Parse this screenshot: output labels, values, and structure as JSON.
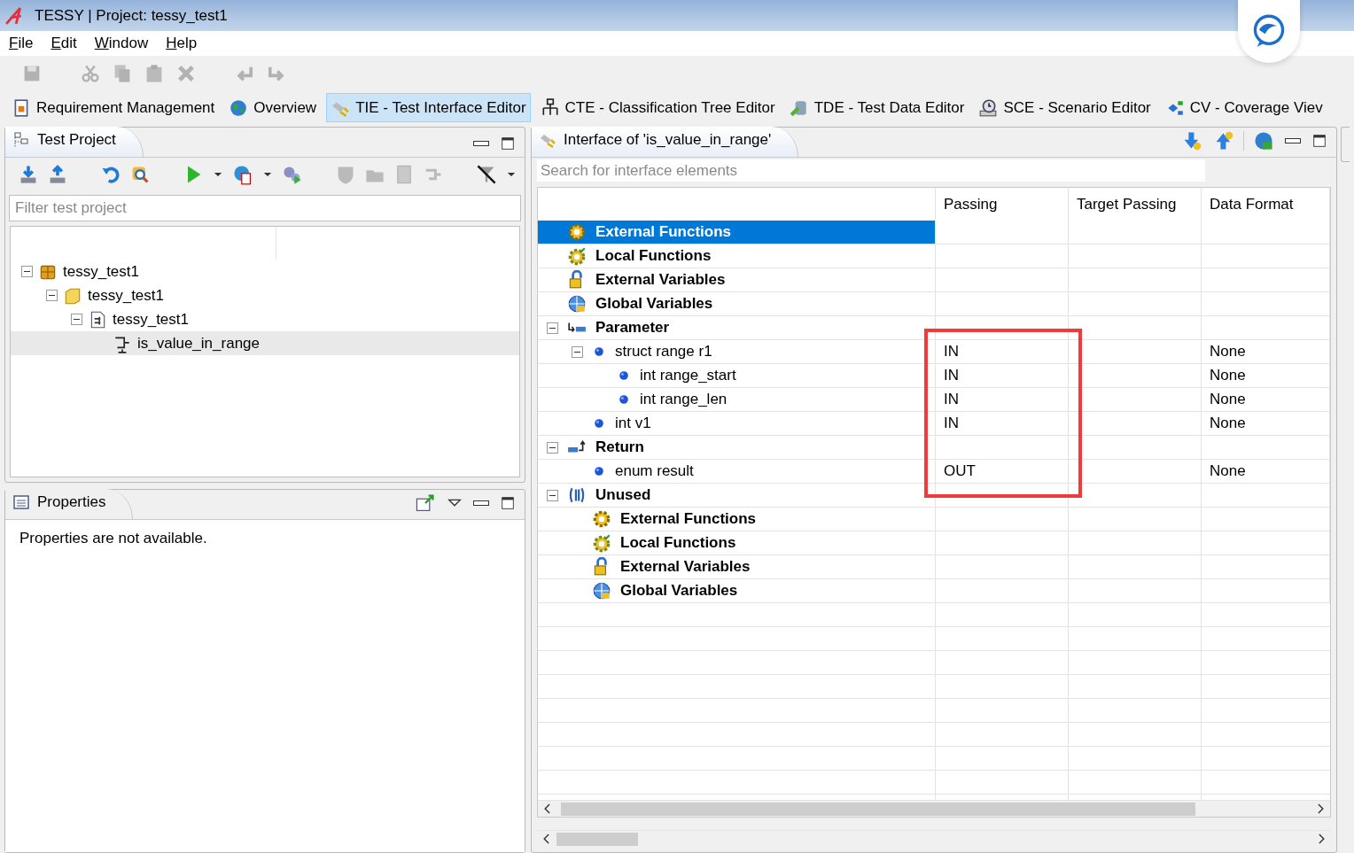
{
  "window": {
    "title": "TESSY | Project: tessy_test1"
  },
  "menu": [
    {
      "label": "File"
    },
    {
      "label": "Edit"
    },
    {
      "label": "Window"
    },
    {
      "label": "Help"
    }
  ],
  "toolbar": [
    {
      "kind": "save",
      "disabled": true
    },
    {
      "kind": "sep"
    },
    {
      "kind": "cut",
      "disabled": true
    },
    {
      "kind": "copy",
      "disabled": true
    },
    {
      "kind": "paste",
      "disabled": true
    },
    {
      "kind": "delete",
      "disabled": true
    },
    {
      "kind": "sep"
    },
    {
      "kind": "undo",
      "disabled": true
    },
    {
      "kind": "redo",
      "disabled": true
    }
  ],
  "perspectives": [
    {
      "label": "Requirement Management",
      "kind": "req",
      "selected": false
    },
    {
      "label": "Overview",
      "kind": "globe",
      "selected": false
    },
    {
      "label": "TIE - Test Interface Editor",
      "kind": "tie",
      "selected": true
    },
    {
      "label": "CTE - Classification Tree Editor",
      "kind": "cte",
      "selected": false
    },
    {
      "label": "TDE - Test Data Editor",
      "kind": "tde",
      "selected": false
    },
    {
      "label": "SCE - Scenario Editor",
      "kind": "sce",
      "selected": false
    },
    {
      "label": "CV - Coverage Viev",
      "kind": "cv",
      "selected": false
    }
  ],
  "test_project": {
    "title": "Test Project",
    "filter_placeholder": "Filter test project",
    "toolbar": [
      {
        "kind": "import",
        "disabled": false
      },
      {
        "kind": "export",
        "disabled": false
      },
      {
        "kind": "sep"
      },
      {
        "kind": "revert",
        "disabled": false
      },
      {
        "kind": "find",
        "disabled": false
      },
      {
        "kind": "sep"
      },
      {
        "kind": "run",
        "disabled": false
      },
      {
        "kind": "caret",
        "disabled": false
      },
      {
        "kind": "report",
        "disabled": false
      },
      {
        "kind": "caret",
        "disabled": false
      },
      {
        "kind": "gears",
        "disabled": false
      },
      {
        "kind": "sep"
      },
      {
        "kind": "add-shield",
        "disabled": true
      },
      {
        "kind": "add-folder",
        "disabled": true
      },
      {
        "kind": "add-doc",
        "disabled": true
      },
      {
        "kind": "add-link",
        "disabled": true
      },
      {
        "kind": "sep"
      },
      {
        "kind": "filter",
        "disabled": false
      },
      {
        "kind": "caret",
        "disabled": false
      }
    ],
    "tree": [
      {
        "label": "tessy_test1",
        "kind": "project",
        "expanded": true,
        "selected": false,
        "children": [
          {
            "label": "tessy_test1",
            "kind": "folder",
            "expanded": true,
            "selected": false,
            "children": [
              {
                "label": "tessy_test1",
                "kind": "module",
                "expanded": true,
                "selected": false,
                "children": [
                  {
                    "label": "is_value_in_range",
                    "kind": "testobject",
                    "selected": true
                  }
                ]
              }
            ]
          }
        ]
      }
    ]
  },
  "properties": {
    "title": "Properties",
    "message": "Properties are not available."
  },
  "interface": {
    "title": "Interface of 'is_value_in_range'",
    "search_placeholder": "Search for interface elements",
    "columns": [
      "Passing",
      "Target Passing",
      "Data Format"
    ],
    "rows": [
      {
        "label": "External Functions",
        "kind": "ext-functions",
        "selected": true
      },
      {
        "label": "Local Functions",
        "kind": "local-functions",
        "selected": false
      },
      {
        "label": "External Variables",
        "kind": "ext-variables",
        "selected": false
      },
      {
        "label": "Global Variables",
        "kind": "global-variables",
        "selected": false
      },
      {
        "label": "Parameter",
        "kind": "parameter",
        "selected": false,
        "expanded": true,
        "children": [
          {
            "label": "struct range r1",
            "kind": "variable",
            "selected": false,
            "expanded": true,
            "passing": "IN",
            "data_format": "None",
            "highlighted": true,
            "children": [
              {
                "label": "int range_start",
                "kind": "variable",
                "selected": false,
                "passing": "IN",
                "data_format": "None",
                "highlighted": true
              },
              {
                "label": "int range_len",
                "kind": "variable",
                "selected": false,
                "passing": "IN",
                "data_format": "None",
                "highlighted": true
              }
            ]
          },
          {
            "label": "int v1",
            "kind": "variable",
            "selected": false,
            "passing": "IN",
            "data_format": "None",
            "highlighted": true
          }
        ]
      },
      {
        "label": "Return",
        "kind": "return",
        "selected": false,
        "expanded": true,
        "highlighted": true,
        "children": [
          {
            "label": "enum result",
            "kind": "variable",
            "selected": false,
            "passing": "OUT",
            "data_format": "None",
            "highlighted": true
          }
        ]
      },
      {
        "label": "Unused",
        "kind": "unused",
        "selected": false,
        "expanded": true,
        "children": [
          {
            "label": "External Functions",
            "kind": "ext-functions",
            "selected": false
          },
          {
            "label": "Local Functions",
            "kind": "local-functions",
            "selected": false
          },
          {
            "label": "External Variables",
            "kind": "ext-variables",
            "selected": false
          },
          {
            "label": "Global Variables",
            "kind": "global-variables",
            "selected": false
          }
        ]
      }
    ]
  }
}
